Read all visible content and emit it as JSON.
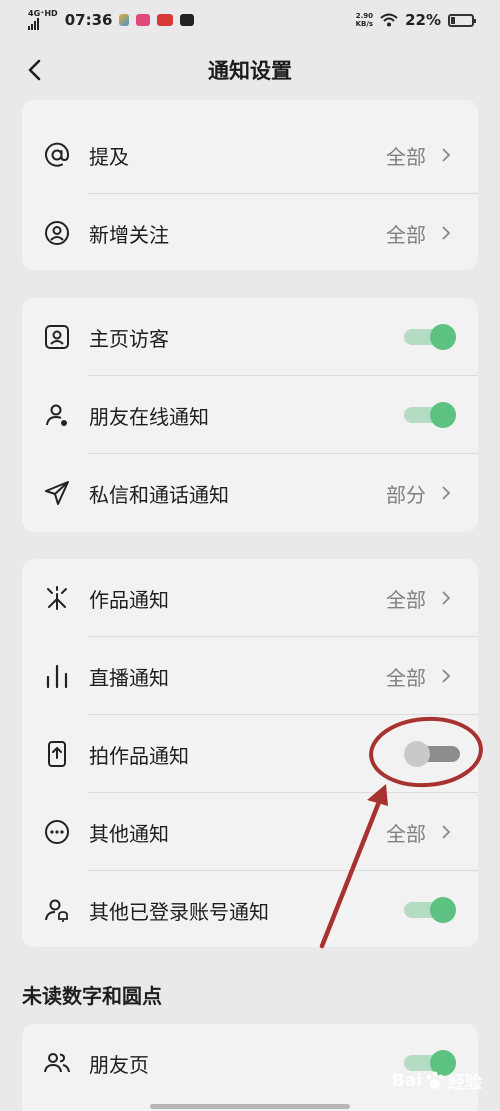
{
  "status_bar": {
    "network": "4G⁺HD",
    "time": "07:36",
    "speed_value": "2.90",
    "speed_unit": "KB/s",
    "battery": "22%",
    "battery_level": 0.22
  },
  "header": {
    "title": "通知设置"
  },
  "cards": {
    "interaction": {
      "mention": {
        "label": "提及",
        "value": "全部",
        "icon": "at-icon"
      },
      "new_follow": {
        "label": "新增关注",
        "value": "全部",
        "icon": "user-circle-icon"
      }
    },
    "social": {
      "profile_visitors": {
        "label": "主页访客",
        "enabled": true,
        "icon": "id-card-icon"
      },
      "friend_online": {
        "label": "朋友在线通知",
        "enabled": true,
        "icon": "user-online-icon"
      },
      "messages_calls": {
        "label": "私信和通话通知",
        "value": "部分",
        "icon": "paper-plane-icon"
      }
    },
    "content": {
      "works": {
        "label": "作品通知",
        "value": "全部",
        "icon": "sparkle-icon"
      },
      "live": {
        "label": "直播通知",
        "value": "全部",
        "icon": "bars-icon"
      },
      "shoot_works": {
        "label": "拍作品通知",
        "enabled": false,
        "icon": "phone-upload-icon"
      },
      "other": {
        "label": "其他通知",
        "value": "全部",
        "icon": "more-circle-icon"
      },
      "other_accounts": {
        "label": "其他已登录账号通知",
        "enabled": true,
        "icon": "user-bell-icon"
      }
    }
  },
  "unread_section": {
    "heading": "未读数字和圆点",
    "friends_page": {
      "label": "朋友页",
      "enabled": true,
      "icon": "users-icon"
    }
  },
  "watermark": {
    "text_latin": "Bai",
    "text_cn": "经验"
  },
  "colors": {
    "toggle_on": "#5cc181",
    "toggle_on_track": "#b4dcc3",
    "toggle_off": "#c9c9c9",
    "annotation_red": "#a8322f"
  }
}
